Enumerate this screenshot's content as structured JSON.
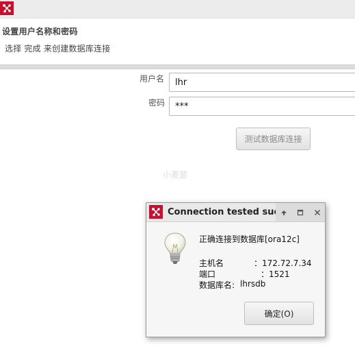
{
  "window": {
    "logo_icon": "network-logo-icon"
  },
  "header": {
    "title": "设置用户名称和密码",
    "description": "选择 完成 来创建数据库连接"
  },
  "form": {
    "username_label": "用户名",
    "username_value": "lhr",
    "password_label": "密码",
    "password_value": "***",
    "test_button": "测试数据库连接"
  },
  "watermark": "小麦苗",
  "dialog": {
    "title": "Connection tested succ",
    "message": "正确连接到数据库[ora12c]",
    "host_label": "主机名",
    "host_value": "：172.72.7.34",
    "port_label": "端口",
    "port_value": "：1521",
    "dbname_label": "数据库名:",
    "dbname_value": "lhrsdb",
    "ok_button": "确定(O)",
    "icon": "lightbulb-icon"
  },
  "colors": {
    "brand_red": "#c8102e"
  }
}
